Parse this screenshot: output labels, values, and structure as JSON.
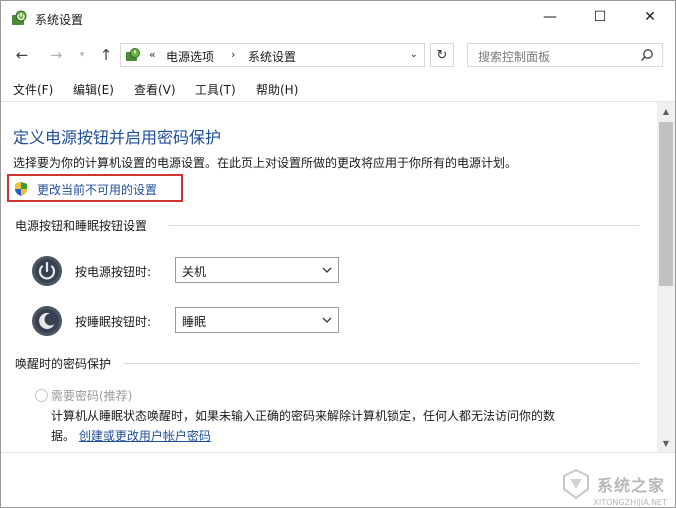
{
  "window": {
    "title": "系统设置",
    "controls": {
      "minimize": "—",
      "maximize": "☐",
      "close": "✕"
    }
  },
  "nav": {
    "back": "←",
    "forward": "→",
    "up": "↑",
    "address": {
      "prefix": "«",
      "crumbs": [
        "电源选项",
        "系统设置"
      ],
      "separator": "›"
    },
    "refresh": "↻",
    "search_placeholder": "搜索控制面板"
  },
  "menu": [
    "文件(F)",
    "编辑(E)",
    "查看(V)",
    "工具(T)",
    "帮助(H)"
  ],
  "main": {
    "title": "定义电源按钮并启用密码保护",
    "description": "选择要为你的计算机设置的电源设置。在此页上对设置所做的更改将应用于你所有的电源计划。",
    "change_link": "更改当前不可用的设置",
    "section_buttons": "电源按钮和睡眠按钮设置",
    "power_button": {
      "label": "按电源按钮时:",
      "value": "关机"
    },
    "sleep_button": {
      "label": "按睡眠按钮时:",
      "value": "睡眠"
    },
    "section_password": "唤醒时的密码保护",
    "password_option": "需要密码(推荐)",
    "info_line1": "计算机从睡眠状态唤醒时，如果未输入正确的密码来解除计算机锁定，任何人都无法访问你的数",
    "info_line2_prefix": "据。",
    "info_link": "创建或更改用户帐户密码"
  },
  "watermark": {
    "text": "系统之家",
    "sub": "XITONGZHIJIA.NET"
  },
  "colors": {
    "title_blue": "#1f4e9a",
    "highlight_red": "#d0342c"
  }
}
